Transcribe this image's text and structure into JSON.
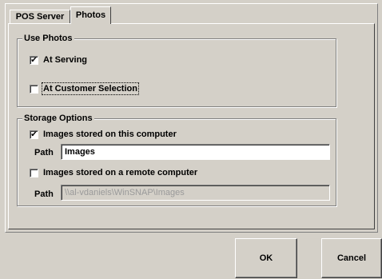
{
  "tabs": [
    {
      "label": "POS Server",
      "active": false
    },
    {
      "label": "Photos",
      "active": true
    }
  ],
  "use_photos": {
    "title": "Use Photos",
    "at_serving": {
      "label": "At Serving",
      "checked": true
    },
    "at_customer_selection": {
      "label": "At Customer Selection",
      "checked": false
    }
  },
  "storage": {
    "title": "Storage Options",
    "local": {
      "label": "Images stored on this computer",
      "checked": true
    },
    "local_path": {
      "label": "Path",
      "value": "Images"
    },
    "remote": {
      "label": "Images stored on a remote computer",
      "checked": false
    },
    "remote_path": {
      "label": "Path",
      "value": "\\\\al-vdaniels\\WinSNAP\\Images"
    }
  },
  "buttons": {
    "ok": "OK",
    "cancel": "Cancel"
  },
  "check_glyph": "✔"
}
